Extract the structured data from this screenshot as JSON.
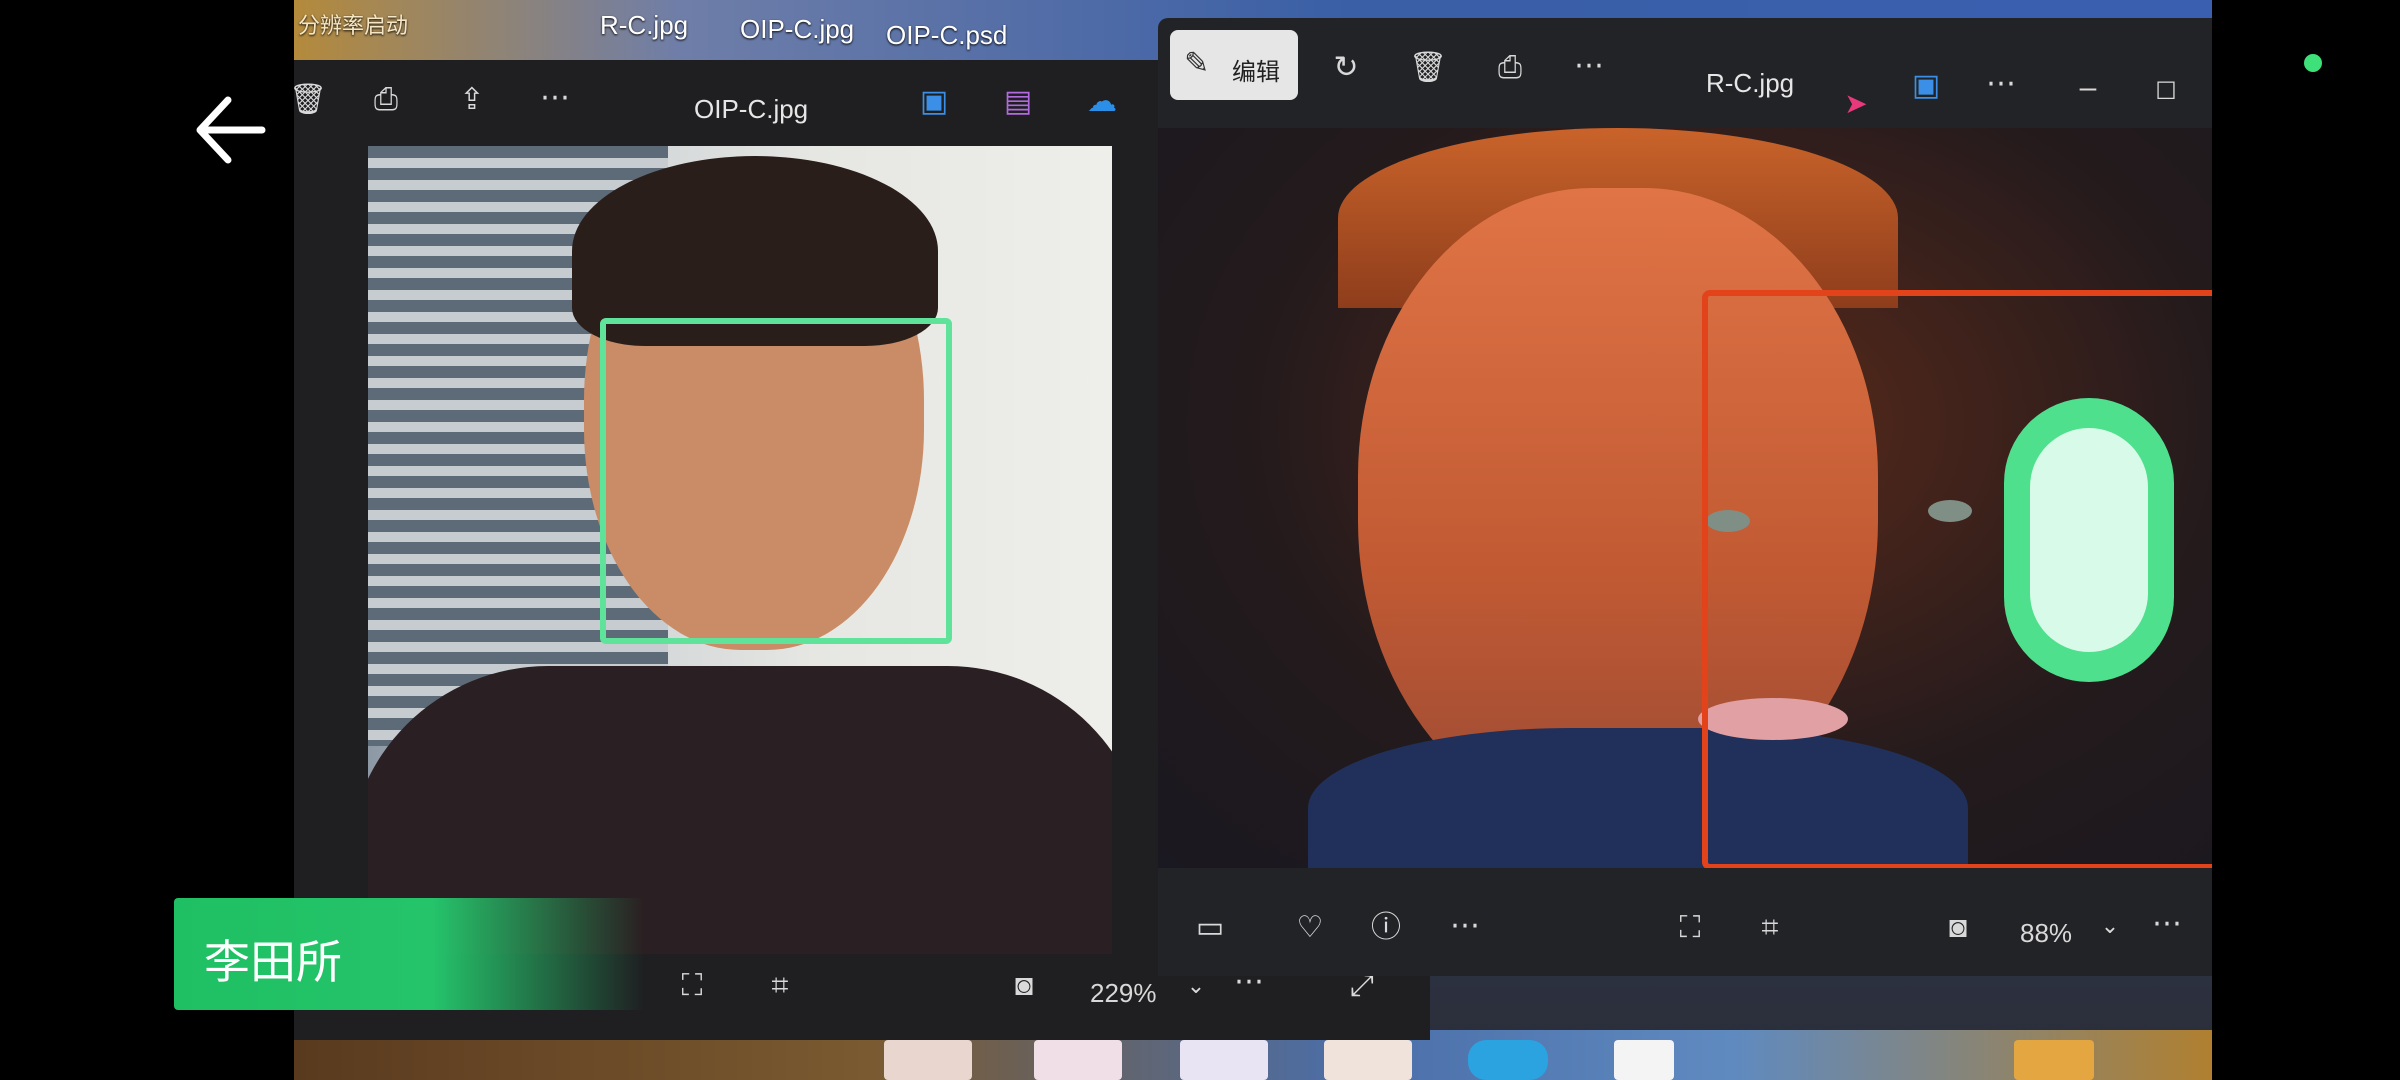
{
  "desktop": {
    "label_partial": "分辨率启动",
    "files": [
      "R-C.jpg",
      "OIP-C.jpg",
      "OIP-C.psd"
    ]
  },
  "left_window": {
    "title": "OIP-C.jpg",
    "zoom": "229%",
    "toolbar_icons": [
      "trash-icon",
      "print-icon",
      "share-icon",
      "more-icon"
    ],
    "right_icons": [
      "photos-app-icon",
      "clipchamp-icon",
      "onedrive-icon"
    ],
    "face_box_color": "#5fe39a"
  },
  "right_window": {
    "title": "R-C.jpg",
    "edit_label": "编辑",
    "zoom": "88%",
    "face_box_color": "#e2431a"
  },
  "overlay": {
    "person_name": "李田所",
    "accent_color": "#23c167",
    "status_dot_color": "#3ee07a"
  }
}
